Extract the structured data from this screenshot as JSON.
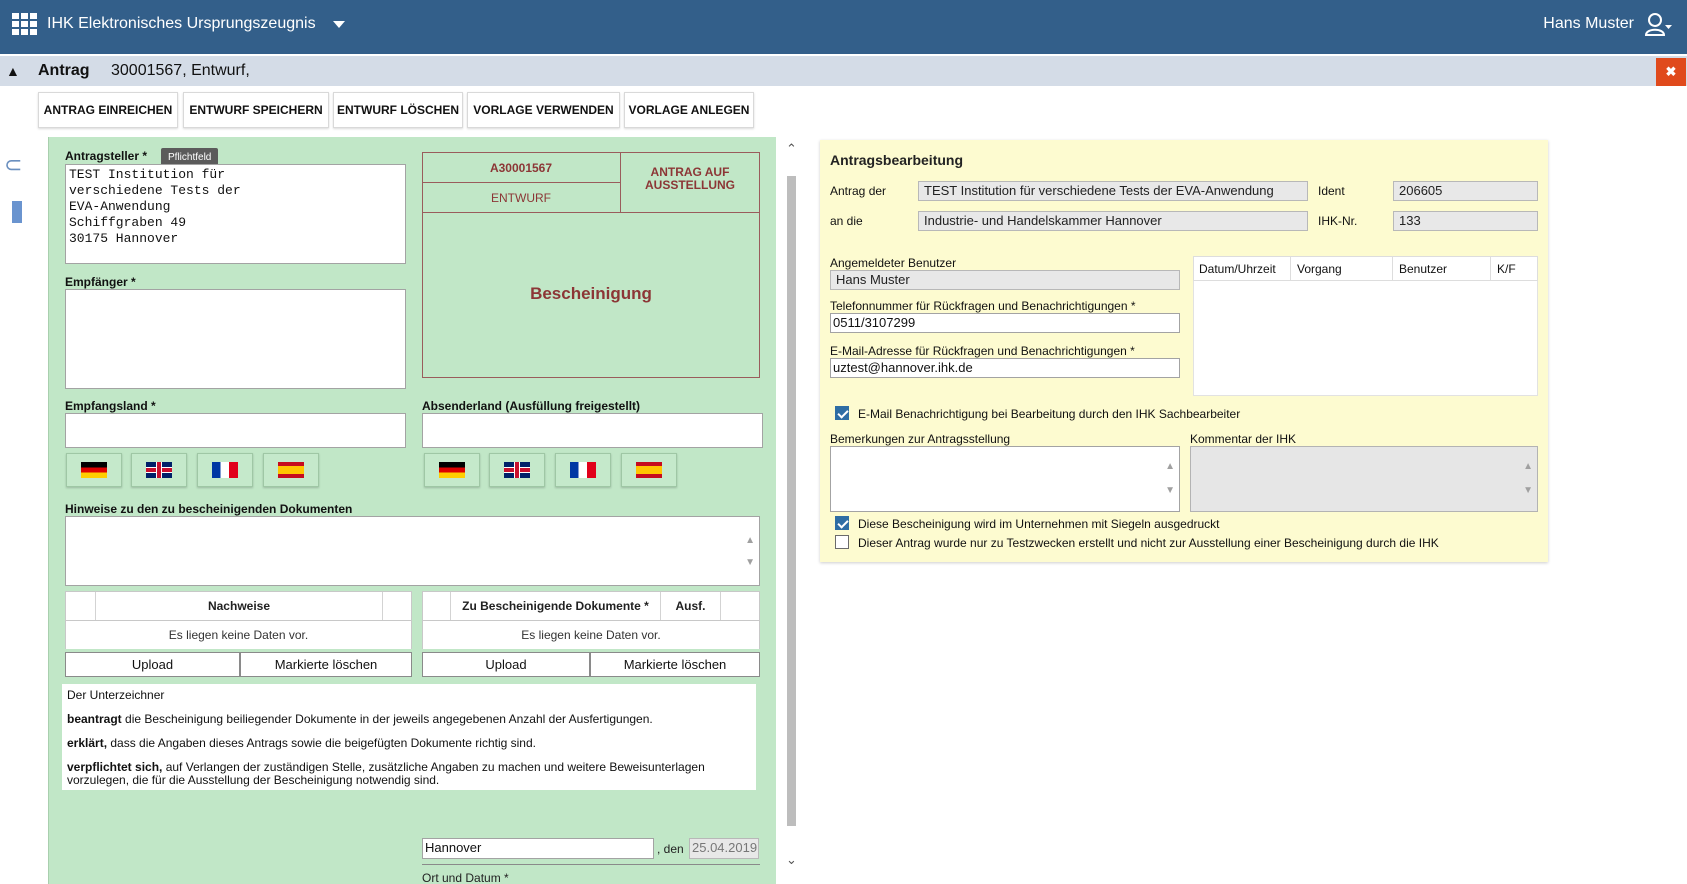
{
  "topbar": {
    "app_title": "IHK Elektronisches Ursprungszeugnis",
    "user_name": "Hans Muster",
    "background": "#335f8a"
  },
  "titlebar": {
    "title": "Antrag",
    "subtitle": "30001567, Entwurf,"
  },
  "toolbar": {
    "submit": "ANTRAG EINREICHEN",
    "save_draft": "ENTWURF SPEICHERN",
    "delete_draft": "ENTWURF LÖSCHEN",
    "use_template": "VORLAGE VERWENDEN",
    "create_template": "VORLAGE ANLEGEN"
  },
  "form": {
    "applicant_label": "Antragsteller *",
    "tooltip": "Pflichtfeld",
    "applicant_value": "TEST Institution für\nverschiedene Tests der\nEVA-Anwendung\nSchiffgraben 49\n30175 Hannover",
    "recipient_label": "Empfänger *",
    "recipient_value": "",
    "dest_country_label": "Empfangsland *",
    "dest_country_value": "",
    "sender_country_label": "Absenderland (Ausfüllung freigestellt)",
    "sender_country_value": "",
    "notes_label": "Hinweise zu den zu bescheinigenden Dokumenten",
    "notes_value": ""
  },
  "certificate": {
    "number": "A30001567",
    "status": "ENTWURF",
    "type_line1": "ANTRAG AUF",
    "type_line2": "AUSSTELLUNG",
    "title": "Bescheinigung"
  },
  "evidence_grid": {
    "header": "Nachweise",
    "empty": "Es liegen keine Daten vor.",
    "upload": "Upload",
    "delete_marked": "Markierte löschen"
  },
  "documents_grid": {
    "header": "Zu Bescheinigende Dokumente *",
    "col_copies": "Ausf.",
    "empty": "Es liegen keine Daten vor.",
    "upload": "Upload",
    "delete_marked": "Markierte löschen"
  },
  "declaration": {
    "intro": "Der Unterzeichner",
    "p1_bold": "beantragt",
    "p1_rest": " die Bescheinigung beiliegender Dokumente in der jeweils angegebenen Anzahl der Ausfertigungen.",
    "p2_bold": "erklärt,",
    "p2_rest": " dass die Angaben dieses Antrags sowie die beigefügten Dokumente richtig sind.",
    "p3_bold": "verpflichtet sich,",
    "p3_rest": " auf Verlangen der zuständigen Stelle, zusätzliche Angaben zu machen und weitere Beweisunterlagen vorzulegen, die für die Ausstellung der Bescheinigung notwendig sind."
  },
  "signature": {
    "place": "Hannover",
    "den": ", den",
    "date": "25.04.2019",
    "label": "Ort und Datum *"
  },
  "processing": {
    "title": "Antragsbearbeitung",
    "request_of_label": "Antrag der",
    "request_of_value": "TEST Institution für verschiedene Tests der EVA-Anwendung",
    "ident_label": "Ident",
    "ident_value": "206605",
    "to_label": "an die",
    "to_value": "Industrie- und Handelskammer Hannover",
    "ihk_nr_label": "IHK-Nr.",
    "ihk_nr_value": "133",
    "user_label": "Angemeldeter Benutzer",
    "user_value": "Hans Muster",
    "phone_label": "Telefonnummer für Rückfragen und Benachrichtigungen *",
    "phone_value": "0511/3107299",
    "email_label": "E-Mail-Adresse für Rückfragen und Benachrichtigungen *",
    "email_value": "uztest@hannover.ihk.de",
    "history_cols": [
      "Datum/Uhrzeit",
      "Vorgang",
      "Benutzer",
      "K/F"
    ],
    "notify_label": "E-Mail Benachrichtigung bei Bearbeitung durch den IHK Sachbearbeiter",
    "notify_checked": true,
    "remarks_label": "Bemerkungen zur Antragsstellung",
    "remarks_value": "",
    "ihk_comment_label": "Kommentar der IHK",
    "ihk_comment_value": "",
    "seal_label": "Diese Bescheinigung wird im Unternehmen mit Siegeln ausgedruckt",
    "seal_checked": true,
    "test_label": "Dieser Antrag wurde nur zu Testzwecken erstellt und nicht zur Ausstellung einer Bescheinigung durch die IHK",
    "test_checked": false
  },
  "colors": {
    "form_bg": "#c1e7c7",
    "processing_bg": "#fdfbd0",
    "close_red": "#e04a1c",
    "cert_red": "#8c3636"
  }
}
